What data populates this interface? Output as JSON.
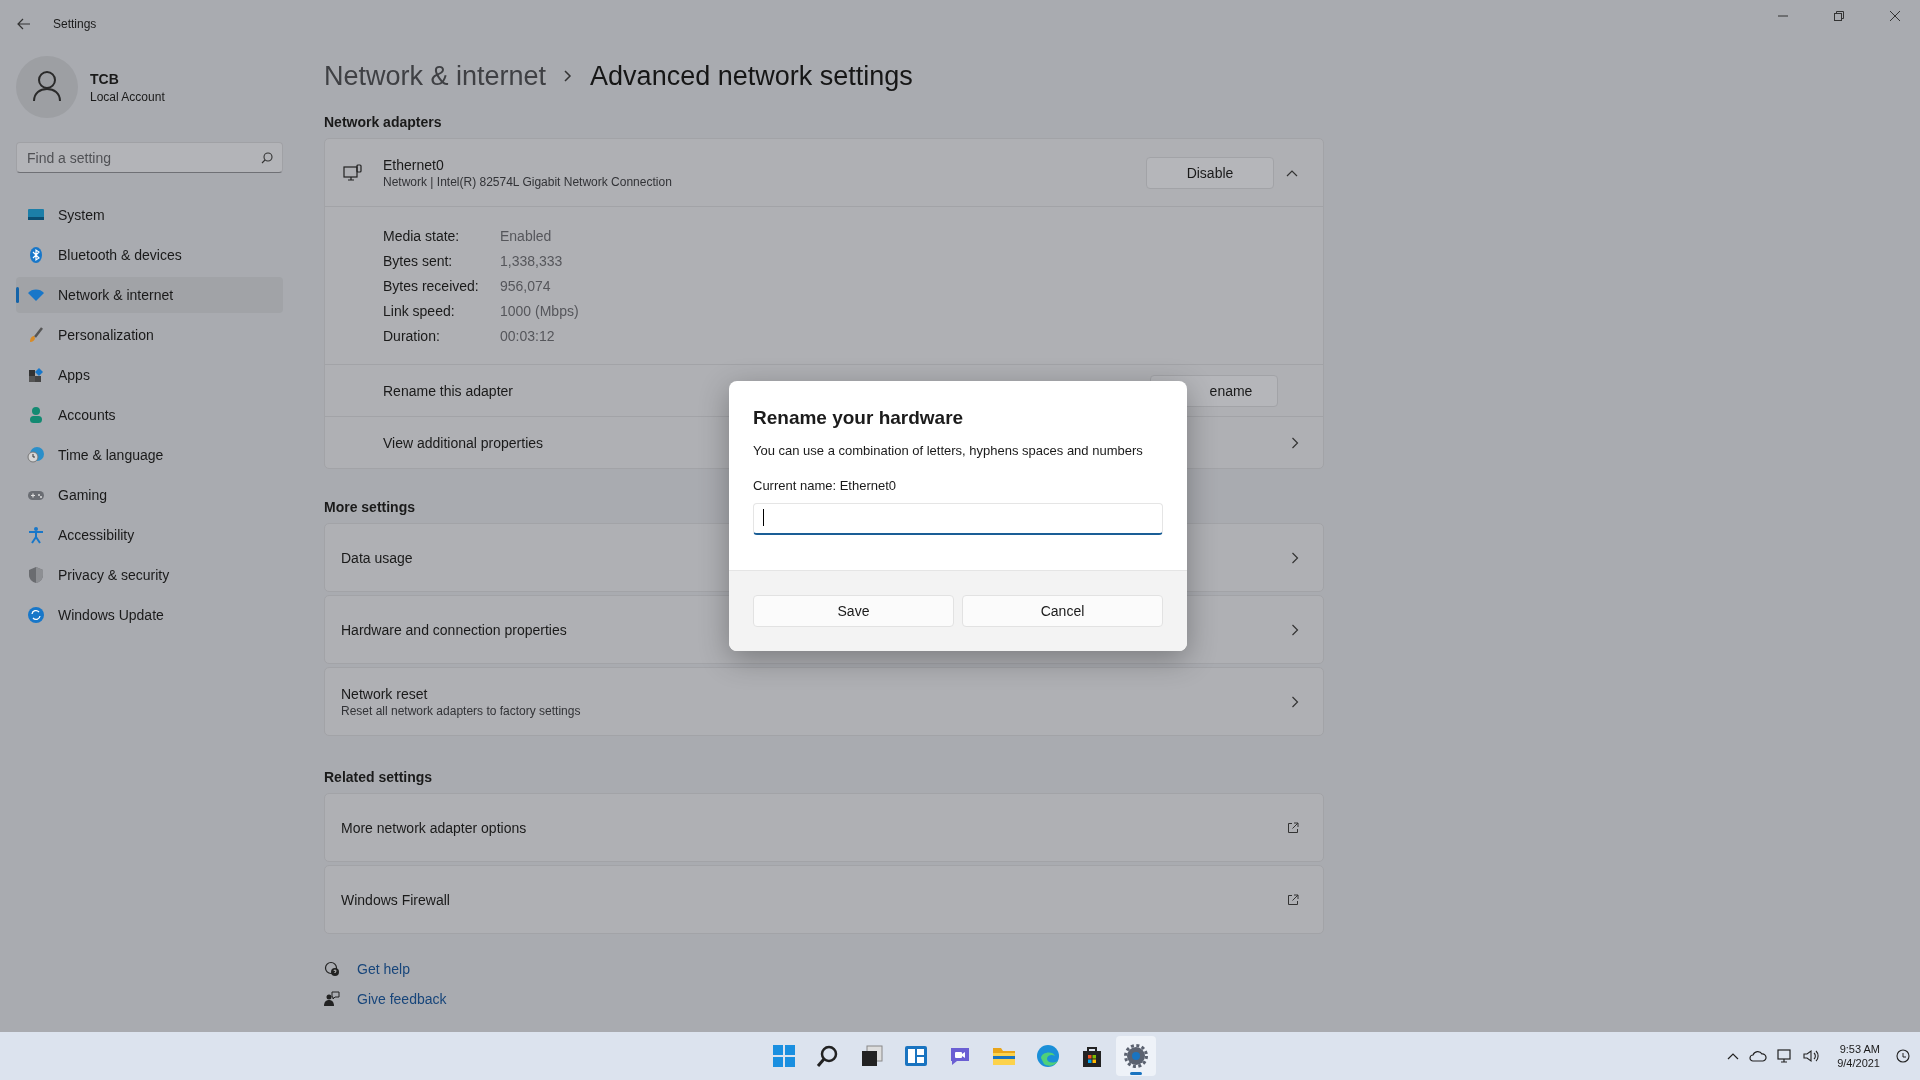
{
  "window": {
    "title": "Settings"
  },
  "user": {
    "name": "TCB",
    "account": "Local Account"
  },
  "search": {
    "placeholder": "Find a setting"
  },
  "nav": [
    {
      "label": "System",
      "selected": false
    },
    {
      "label": "Bluetooth & devices",
      "selected": false
    },
    {
      "label": "Network & internet",
      "selected": true
    },
    {
      "label": "Personalization",
      "selected": false
    },
    {
      "label": "Apps",
      "selected": false
    },
    {
      "label": "Accounts",
      "selected": false
    },
    {
      "label": "Time & language",
      "selected": false
    },
    {
      "label": "Gaming",
      "selected": false
    },
    {
      "label": "Accessibility",
      "selected": false
    },
    {
      "label": "Privacy & security",
      "selected": false
    },
    {
      "label": "Windows Update",
      "selected": false
    }
  ],
  "breadcrumb": [
    "Network & internet",
    "Advanced network settings"
  ],
  "adapter_section": {
    "title": "Network adapters",
    "adapter": {
      "name": "Ethernet0",
      "description": "Network | Intel(R) 82574L Gigabit Network Connection",
      "button": "Disable",
      "expanded": true,
      "details": [
        {
          "label": "Media state:",
          "value": "Enabled"
        },
        {
          "label": "Bytes sent:",
          "value": "1,338,333"
        },
        {
          "label": "Bytes received:",
          "value": "956,074"
        },
        {
          "label": "Link speed:",
          "value": "1000 (Mbps)"
        },
        {
          "label": "Duration:",
          "value": "00:03:12"
        }
      ],
      "rows": [
        {
          "kind": "button",
          "label": "Rename this adapter",
          "button": "ename"
        },
        {
          "kind": "chevron",
          "label": "View additional properties"
        }
      ]
    }
  },
  "more_settings": {
    "title": "More settings",
    "rows": [
      {
        "kind": "chevron",
        "label": "Data usage"
      },
      {
        "kind": "chevron",
        "label": "Hardware and connection properties"
      },
      {
        "kind": "chevron",
        "label": "Network reset",
        "description": "Reset all network adapters to factory settings"
      }
    ]
  },
  "related_settings": {
    "title": "Related settings",
    "rows": [
      {
        "kind": "external",
        "label": "More network adapter options"
      },
      {
        "kind": "external",
        "label": "Windows Firewall"
      }
    ]
  },
  "help_links": [
    "Get help",
    "Give feedback"
  ],
  "dialog": {
    "title": "Rename your hardware",
    "message": "You can use a combination of letters, hyphens spaces and numbers",
    "current_name": "Current name: Ethernet0",
    "buttons": [
      "Save",
      "Cancel"
    ]
  },
  "taskbar": {
    "apps": [
      {
        "selected": false
      },
      {
        "selected": false
      },
      {
        "selected": false
      },
      {
        "selected": false
      },
      {
        "selected": false
      },
      {
        "selected": false
      },
      {
        "selected": false
      },
      {
        "selected": false
      },
      {
        "selected": true
      }
    ],
    "clock": {
      "time": "9:53 AM",
      "date": "9/4/2021"
    }
  }
}
